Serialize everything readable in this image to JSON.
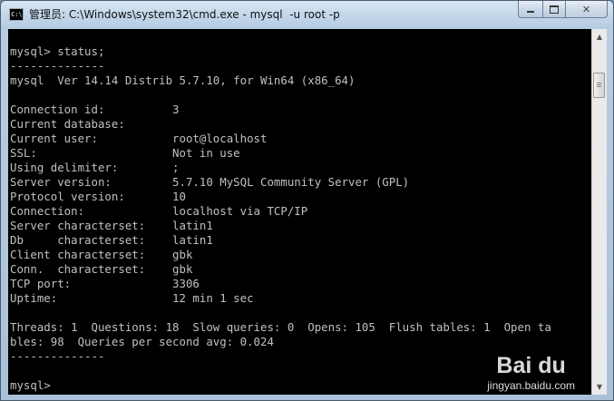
{
  "window": {
    "title": "管理员: C:\\Windows\\system32\\cmd.exe - mysql  -u root -p",
    "icon_label": "C:\\"
  },
  "console": {
    "lines": [
      "mysql> status;",
      "--------------",
      "mysql  Ver 14.14 Distrib 5.7.10, for Win64 (x86_64)",
      "",
      "Connection id:          3",
      "Current database:",
      "Current user:           root@localhost",
      "SSL:                    Not in use",
      "Using delimiter:        ;",
      "Server version:         5.7.10 MySQL Community Server (GPL)",
      "Protocol version:       10",
      "Connection:             localhost via TCP/IP",
      "Server characterset:    latin1",
      "Db     characterset:    latin1",
      "Client characterset:    gbk",
      "Conn.  characterset:    gbk",
      "TCP port:               3306",
      "Uptime:                 12 min 1 sec",
      "",
      "Threads: 1  Questions: 18  Slow queries: 0  Opens: 105  Flush tables: 1  Open ta",
      "bles: 98  Queries per second avg: 0.024",
      "--------------",
      "",
      "mysql>"
    ]
  },
  "watermark": {
    "logo": "Bai du",
    "sub": "jingyan.baidu.com"
  },
  "icons": {
    "app": "cmd-icon",
    "minimize": "minimize-icon",
    "maximize": "maximize-icon",
    "close": "close-icon"
  }
}
